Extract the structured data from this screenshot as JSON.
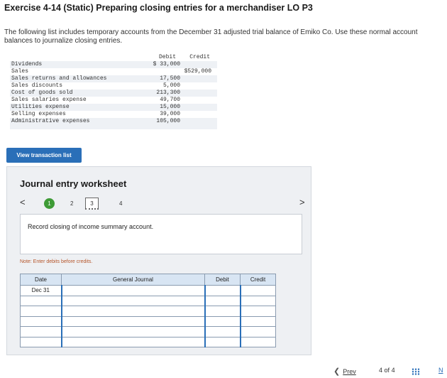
{
  "header": {
    "title": "Exercise 4-14 (Static) Preparing closing entries for a merchandiser LO P3",
    "intro": "The following list includes temporary accounts from the December 31 adjusted trial balance of Emiko Co. Use these normal account balances to journalize closing entries."
  },
  "trial_balance": {
    "debit_header": "Debit",
    "credit_header": "Credit",
    "rows": [
      {
        "account": "Dividends",
        "debit": "$ 33,000",
        "credit": ""
      },
      {
        "account": "Sales",
        "debit": "",
        "credit": "$529,000"
      },
      {
        "account": "Sales returns and allowances",
        "debit": "17,500",
        "credit": ""
      },
      {
        "account": "Sales discounts",
        "debit": "5,000",
        "credit": ""
      },
      {
        "account": "Cost of goods sold",
        "debit": "213,300",
        "credit": ""
      },
      {
        "account": "Sales salaries expense",
        "debit": "49,700",
        "credit": ""
      },
      {
        "account": "Utilities expense",
        "debit": "15,000",
        "credit": ""
      },
      {
        "account": "Selling expenses",
        "debit": "39,000",
        "credit": ""
      },
      {
        "account": "Administrative expenses",
        "debit": "105,000",
        "credit": ""
      }
    ]
  },
  "view_button": "View transaction list",
  "worksheet": {
    "title": "Journal entry worksheet",
    "nav_prev": "<",
    "nav_next": ">",
    "steps": [
      "1",
      "2",
      "3",
      "4"
    ],
    "instruction": "Record closing of income summary account.",
    "note": "Note: Enter debits before credits.",
    "columns": {
      "date": "Date",
      "general_journal": "General Journal",
      "debit": "Debit",
      "credit": "Credit"
    },
    "rows": [
      {
        "date": "Dec 31"
      },
      {
        "date": ""
      },
      {
        "date": ""
      },
      {
        "date": ""
      },
      {
        "date": ""
      },
      {
        "date": ""
      }
    ]
  },
  "pager": {
    "prev": "Prev",
    "page": "4",
    "of": "of",
    "total": "4",
    "next": "N"
  }
}
